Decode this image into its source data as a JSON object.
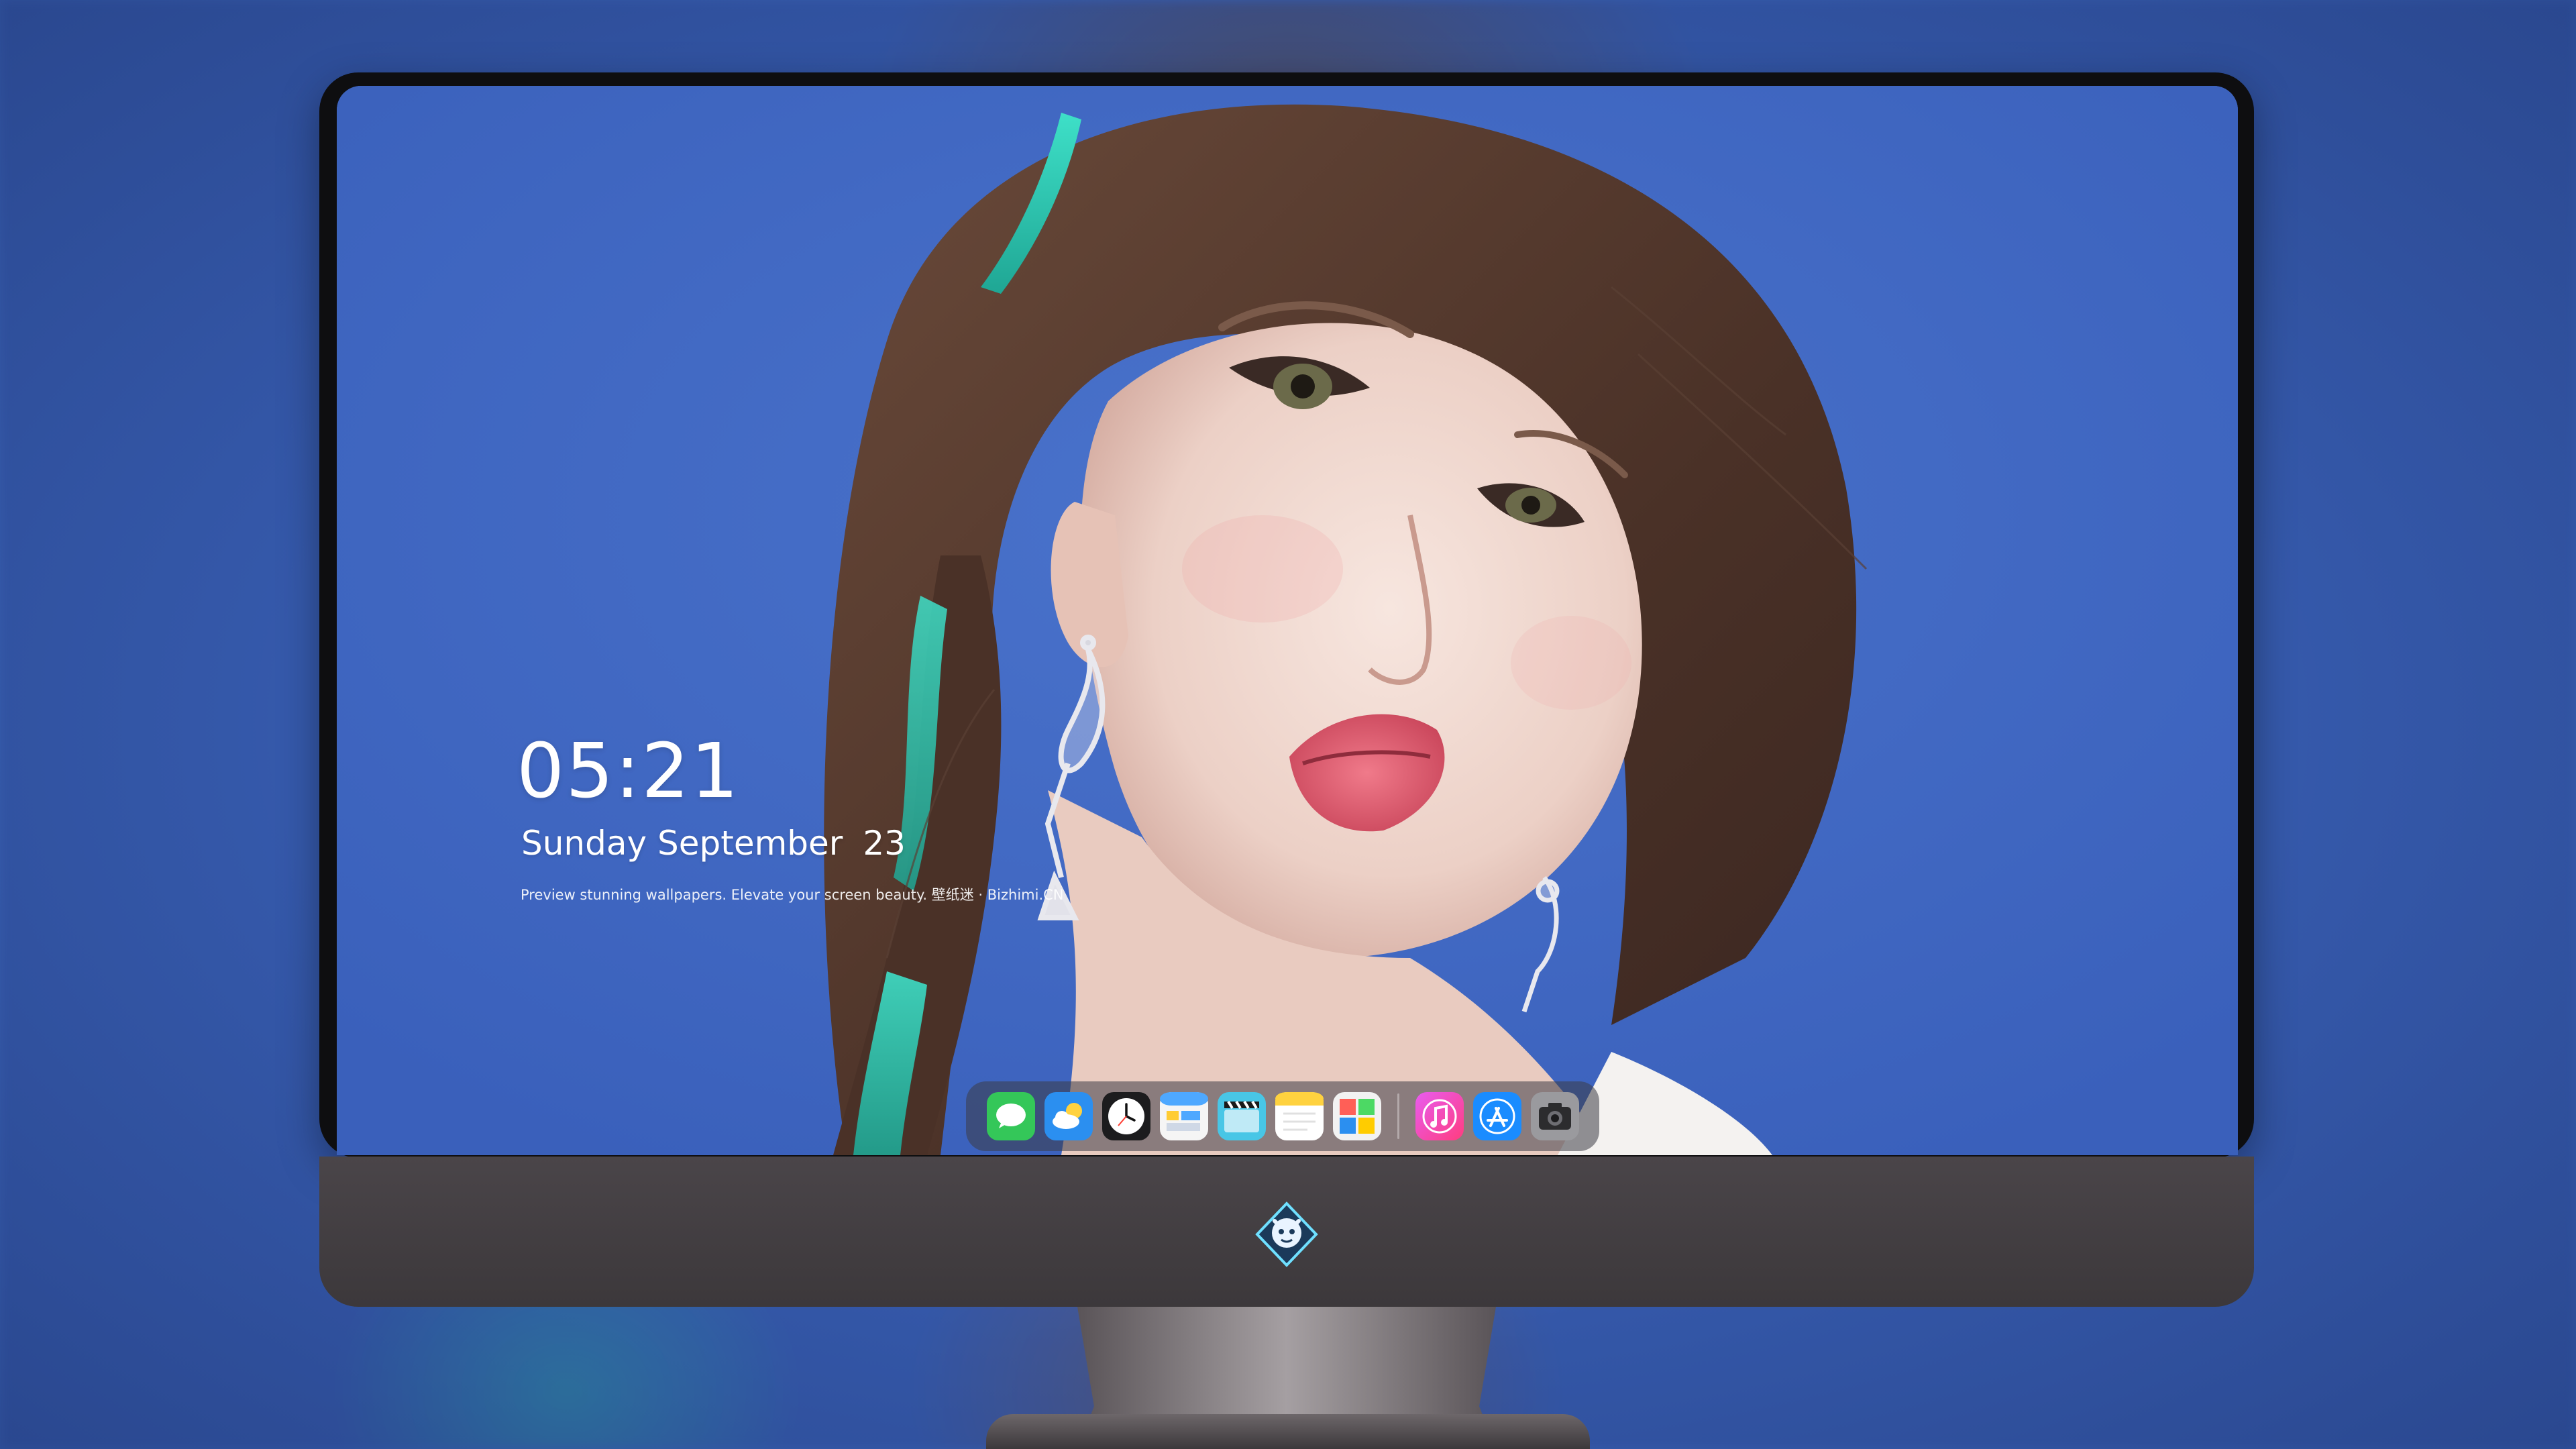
{
  "lock_screen": {
    "time": "05:21",
    "date_text": "Sunday September",
    "date_day": "23",
    "caption": "Preview stunning wallpapers. Elevate your screen beauty. 壁纸迷 · Bizhimi.CN"
  },
  "dock": {
    "apps": [
      {
        "icon": "messages-icon"
      },
      {
        "icon": "weather-icon"
      },
      {
        "icon": "clock-icon"
      },
      {
        "icon": "calendar-icon"
      },
      {
        "icon": "video-icon"
      },
      {
        "icon": "notes-icon"
      },
      {
        "icon": "gallery-icon"
      },
      {
        "icon": "music-icon"
      },
      {
        "icon": "app-store-icon"
      },
      {
        "icon": "camera-icon"
      }
    ]
  },
  "colors": {
    "background_blue": "#3f66c1",
    "monitor_bezel": "#0e0e10",
    "chin": "#433e41"
  },
  "monitor": {
    "logo": "avatar-badge-icon"
  }
}
